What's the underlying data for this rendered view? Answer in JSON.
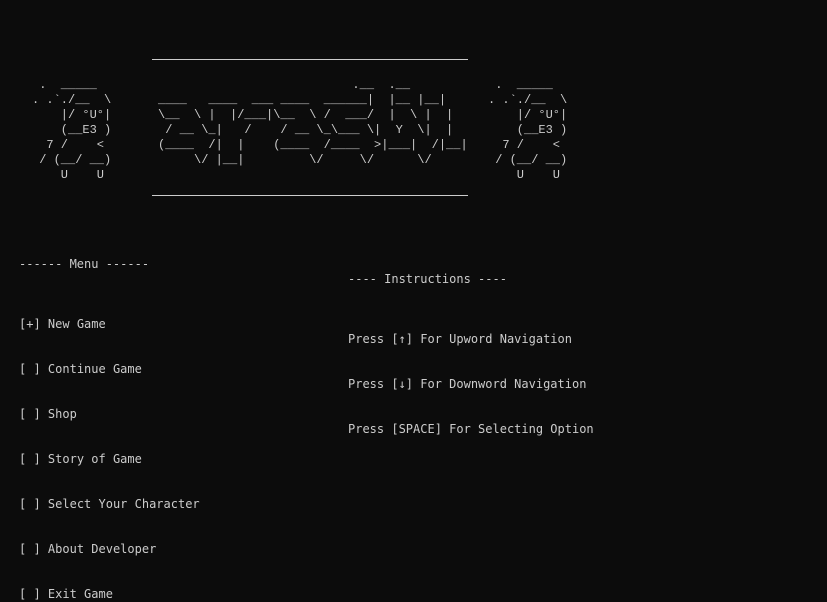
{
  "banner": {
    "character_left": [
      " .  _____",
      ". .`./__  \\",
      "    |/ °U°|",
      "    (__E3 )",
      "  7 /    <",
      " / (__/ __)",
      "    U    U"
    ],
    "title_art": [
      "                           .__  .__",
      "____   ____  ___ ____  ______|  |__ |__|",
      "\\__  \\ |  |/___|\\__  \\ /  ___/  |  \\ |  |",
      " / __ \\_|   /    / __ \\_\\___ \\|  Y  \\|  |",
      "(____  /|  |    (____  /____  >|___|  /|__|",
      "     \\/ |__|         \\/     \\/      \\/"
    ],
    "character_right": [
      " .  _____",
      ". .`./__  \\",
      "    |/ °U°|",
      "    (__E3 )",
      "  7 /    <",
      " / (__/ __)",
      "    U    U"
    ]
  },
  "menu": {
    "header": "------ Menu ------",
    "items": [
      {
        "marker": "[+]",
        "label": "New Game",
        "selected": true
      },
      {
        "marker": "[ ]",
        "label": "Continue Game",
        "selected": false
      },
      {
        "marker": "[ ]",
        "label": "Shop",
        "selected": false
      },
      {
        "marker": "[ ]",
        "label": "Story of Game",
        "selected": false
      },
      {
        "marker": "[ ]",
        "label": "Select Your Character",
        "selected": false
      },
      {
        "marker": "[ ]",
        "label": "About Developer",
        "selected": false
      },
      {
        "marker": "[ ]",
        "label": "Exit Game",
        "selected": false
      }
    ]
  },
  "instructions": {
    "header": "---- Instructions ----",
    "lines": [
      "Press [↑] For Upword Navigation",
      "Press [↓] For Downword Navigation",
      "Press [SPACE] For Selecting Option"
    ]
  },
  "colors": {
    "background": "#0c0c0c",
    "text": "#cccccc"
  }
}
